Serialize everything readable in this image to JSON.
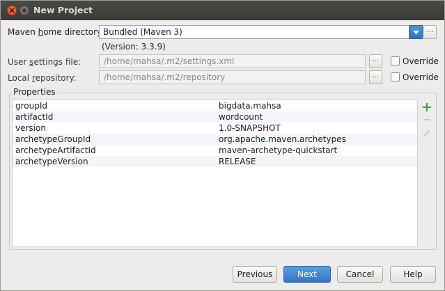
{
  "window": {
    "title": "New Project"
  },
  "maven_home": {
    "label_pre": "Maven ",
    "label_mnemonic": "h",
    "label_post": "ome directory:",
    "value": "Bundled (Maven 3)",
    "version": "(Version: 3.3.9)",
    "browse_label": "..."
  },
  "user_settings": {
    "label_pre": "User ",
    "label_mnemonic": "s",
    "label_post": "ettings file:",
    "value": "/home/mahsa/.m2/settings.xml",
    "browse_label": "...",
    "override_label": "Override"
  },
  "local_repo": {
    "label_pre": "Local ",
    "label_mnemonic": "r",
    "label_post": "epository:",
    "value": "/home/mahsa/.m2/repository",
    "browse_label": "...",
    "override_label": "Override"
  },
  "properties": {
    "title": "Properties",
    "rows": [
      {
        "key": "groupId",
        "value": "bigdata.mahsa"
      },
      {
        "key": "artifactId",
        "value": "wordcount"
      },
      {
        "key": "version",
        "value": "1.0-SNAPSHOT"
      },
      {
        "key": "archetypeGroupId",
        "value": "org.apache.maven.archetypes"
      },
      {
        "key": "archetypeArtifactId",
        "value": "maven-archetype-quickstart"
      },
      {
        "key": "archetypeVersion",
        "value": "RELEASE"
      }
    ]
  },
  "buttons": {
    "previous": "Previous",
    "next": "Next",
    "cancel": "Cancel",
    "help": "Help"
  },
  "colors": {
    "accent": "#3275c6",
    "add_green": "#3d9a3d"
  },
  "icons": [
    "close-icon",
    "minimize-icon",
    "dropdown-arrow-icon",
    "add-icon",
    "remove-icon",
    "edit-icon"
  ]
}
